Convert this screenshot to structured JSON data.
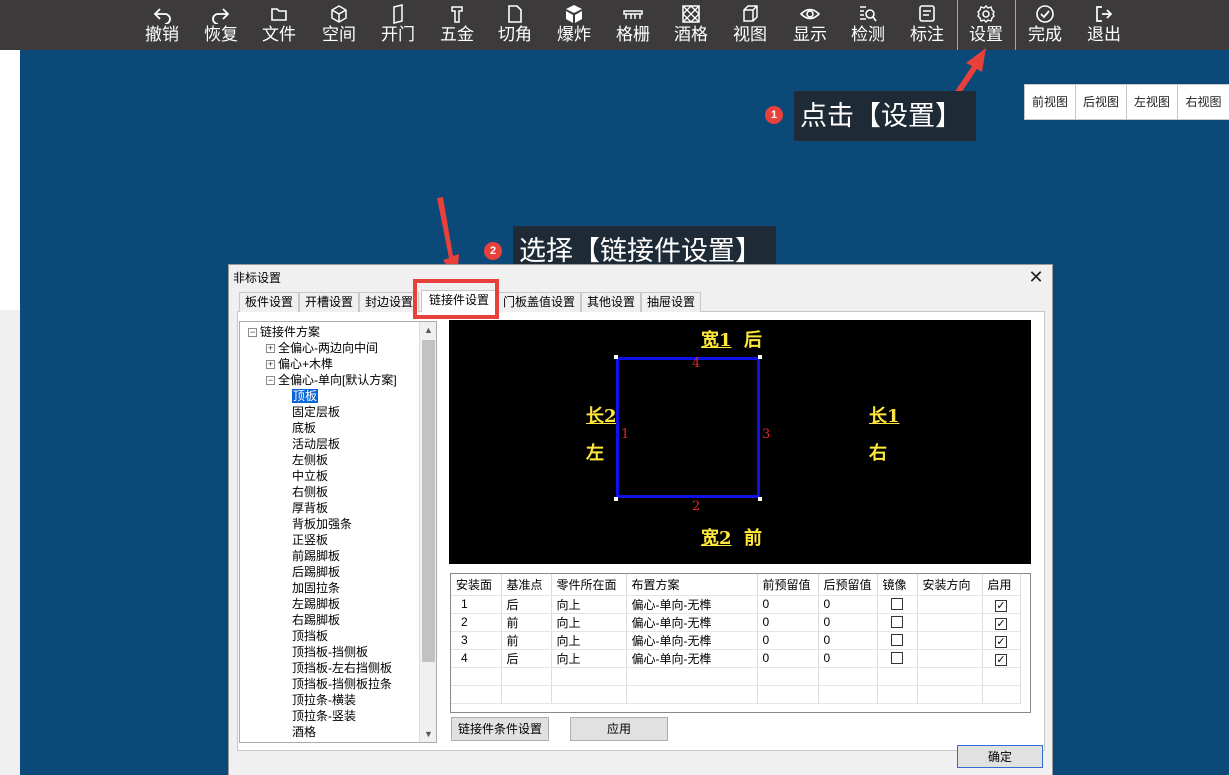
{
  "toolbar": {
    "items": [
      {
        "label": "撤销",
        "icon": "undo-icon"
      },
      {
        "label": "恢复",
        "icon": "redo-icon"
      },
      {
        "label": "文件",
        "icon": "folder-icon"
      },
      {
        "label": "空间",
        "icon": "cube-icon"
      },
      {
        "label": "开门",
        "icon": "door-icon"
      },
      {
        "label": "五金",
        "icon": "hardware-icon"
      },
      {
        "label": "切角",
        "icon": "corner-cut-icon"
      },
      {
        "label": "爆炸",
        "icon": "explode-icon"
      },
      {
        "label": "格栅",
        "icon": "grille-icon"
      },
      {
        "label": "酒格",
        "icon": "wine-rack-icon"
      },
      {
        "label": "视图",
        "icon": "view-cube-icon"
      },
      {
        "label": "显示",
        "icon": "eye-icon"
      },
      {
        "label": "检测",
        "icon": "inspect-icon"
      },
      {
        "label": "标注",
        "icon": "annotation-icon"
      },
      {
        "label": "设置",
        "icon": "gear-icon"
      },
      {
        "label": "完成",
        "icon": "check-circle-icon"
      },
      {
        "label": "退出",
        "icon": "exit-icon"
      }
    ]
  },
  "views": [
    "前视图",
    "后视图",
    "左视图",
    "右视图"
  ],
  "callouts": {
    "step1": {
      "badge": "1",
      "text": "点击【设置】"
    },
    "step2": {
      "badge": "2",
      "text": "选择【链接件设置】"
    }
  },
  "dialog": {
    "title": "非标设置",
    "close": "✕",
    "tabs": [
      "板件设置",
      "开槽设置",
      "封边设置",
      "链接件设置",
      "门板盖值设置",
      "其他设置",
      "抽屉设置"
    ],
    "active_tab": "链接件设置",
    "tree": {
      "root": "链接件方案",
      "groups": [
        {
          "label": "全偏心-两边向中间",
          "expanded": false
        },
        {
          "label": "偏心+木榫",
          "expanded": false
        },
        {
          "label": "全偏心-单向[默认方案]",
          "expanded": true
        }
      ],
      "leaves": [
        "顶板",
        "固定层板",
        "底板",
        "活动层板",
        "左侧板",
        "中立板",
        "右侧板",
        "厚背板",
        "背板加强条",
        "正竖板",
        "前踢脚板",
        "后踢脚板",
        "加固拉条",
        "左踢脚板",
        "右踢脚板",
        "顶挡板",
        "顶挡板-挡侧板",
        "顶挡板-左右挡侧板",
        "顶挡板-挡侧板拉条",
        "顶拉条-横装",
        "顶拉条-竖装",
        "酒格"
      ],
      "selected": "顶板"
    },
    "canvas": {
      "top_label": "宽1",
      "top_dir": "后",
      "bottom_label": "宽2",
      "bottom_dir": "前",
      "left_label": "长2",
      "left_dir": "左",
      "right_label": "长1",
      "right_dir": "右",
      "edge_top": "4",
      "edge_bottom": "2",
      "edge_left": "1",
      "edge_right": "3"
    },
    "grid": {
      "columns": [
        "安装面",
        "基准点",
        "零件所在面",
        "布置方案",
        "前预留值",
        "后预留值",
        "镜像",
        "安装方向",
        "启用"
      ],
      "rows": [
        {
          "face": "1",
          "ref": "后",
          "side": "向上",
          "plan": "偏心-单向-无榫",
          "front": "0",
          "back": "0",
          "mirror": false,
          "dir": "",
          "enabled": true
        },
        {
          "face": "2",
          "ref": "前",
          "side": "向上",
          "plan": "偏心-单向-无榫",
          "front": "0",
          "back": "0",
          "mirror": false,
          "dir": "",
          "enabled": true
        },
        {
          "face": "3",
          "ref": "前",
          "side": "向上",
          "plan": "偏心-单向-无榫",
          "front": "0",
          "back": "0",
          "mirror": false,
          "dir": "",
          "enabled": true
        },
        {
          "face": "4",
          "ref": "后",
          "side": "向上",
          "plan": "偏心-单向-无榫",
          "front": "0",
          "back": "0",
          "mirror": false,
          "dir": "",
          "enabled": true
        }
      ]
    },
    "buttons": {
      "condition": "链接件条件设置",
      "apply": "应用",
      "ok": "确定"
    }
  }
}
